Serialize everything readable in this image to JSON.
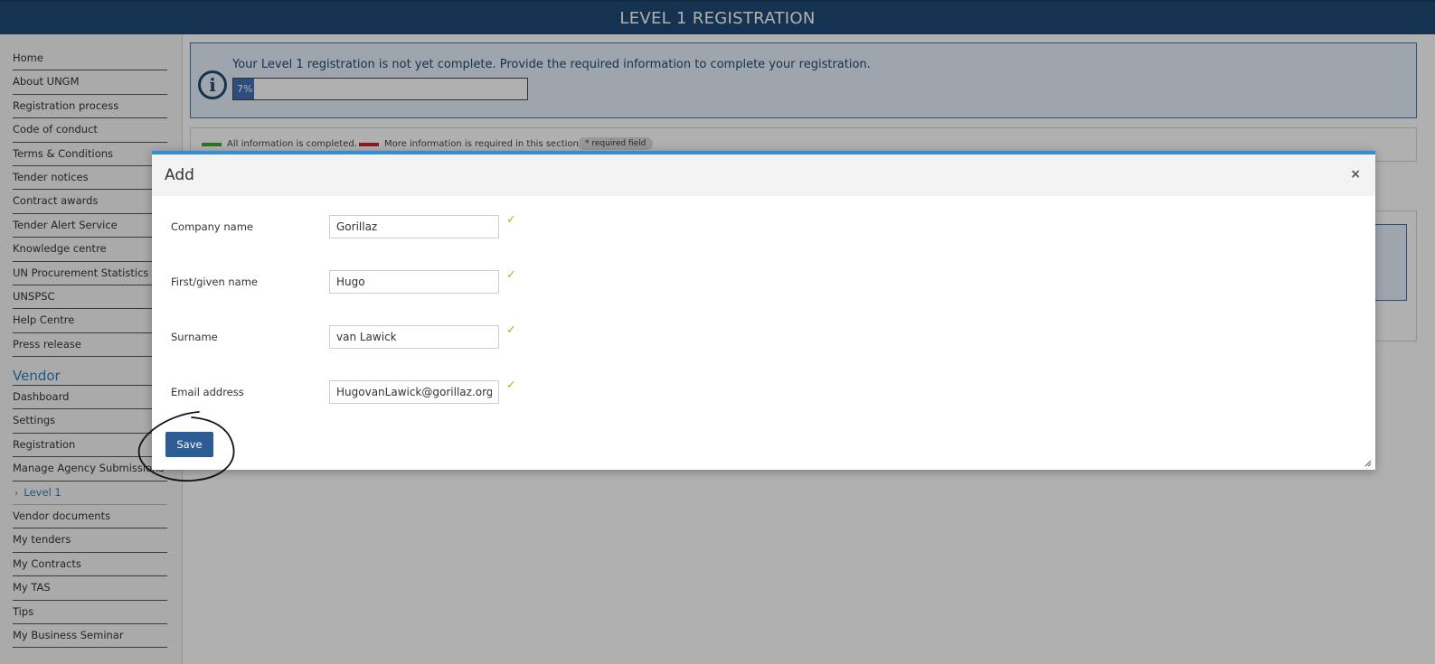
{
  "header": {
    "title": "LEVEL 1 REGISTRATION"
  },
  "sidebar": {
    "items": [
      {
        "label": "Home"
      },
      {
        "label": "About UNGM"
      },
      {
        "label": "Registration process"
      },
      {
        "label": "Code of conduct"
      },
      {
        "label": "Terms & Conditions"
      },
      {
        "label": "Tender notices"
      },
      {
        "label": "Contract awards"
      },
      {
        "label": "Tender Alert Service"
      },
      {
        "label": "Knowledge centre"
      },
      {
        "label": "UN Procurement Statistics"
      },
      {
        "label": "UNSPSC"
      },
      {
        "label": "Help Centre"
      },
      {
        "label": "Press release"
      }
    ],
    "vendor_title": "Vendor",
    "vendor_items": [
      {
        "label": "Dashboard"
      },
      {
        "label": "Settings"
      },
      {
        "label": "Registration"
      },
      {
        "label": "Manage Agency Submissions"
      },
      {
        "label": "Level 1"
      },
      {
        "label": "Vendor documents"
      },
      {
        "label": "My tenders"
      },
      {
        "label": "My Contracts"
      },
      {
        "label": "My TAS"
      },
      {
        "label": "Tips"
      },
      {
        "label": "My Business Seminar"
      }
    ]
  },
  "info": {
    "message": "Your Level 1 registration is not yet complete. Provide the required information to complete your registration.",
    "progress_label": "7%",
    "progress_value": 0.07
  },
  "legend": {
    "complete": "All information is completed.",
    "incomplete": "More information is required in this section.",
    "required": "* required field",
    "complete_color": "#3aaa35",
    "incomplete_color": "#d0202e"
  },
  "modal": {
    "title": "Add",
    "close_glyph": "×",
    "fields": [
      {
        "label": "Company name",
        "value": "Gorillaz"
      },
      {
        "label": "First/given name",
        "value": "Hugo"
      },
      {
        "label": "Surname",
        "value": "van Lawick"
      },
      {
        "label": "Email address",
        "value": "HugovanLawick@gorillaz.org"
      }
    ],
    "check_glyph": "✓",
    "save_label": "Save"
  },
  "colors": {
    "header_bg": "#1f4a75",
    "accent": "#2f8fd8",
    "button": "#2b5d94",
    "check": "#9cbf1a"
  }
}
